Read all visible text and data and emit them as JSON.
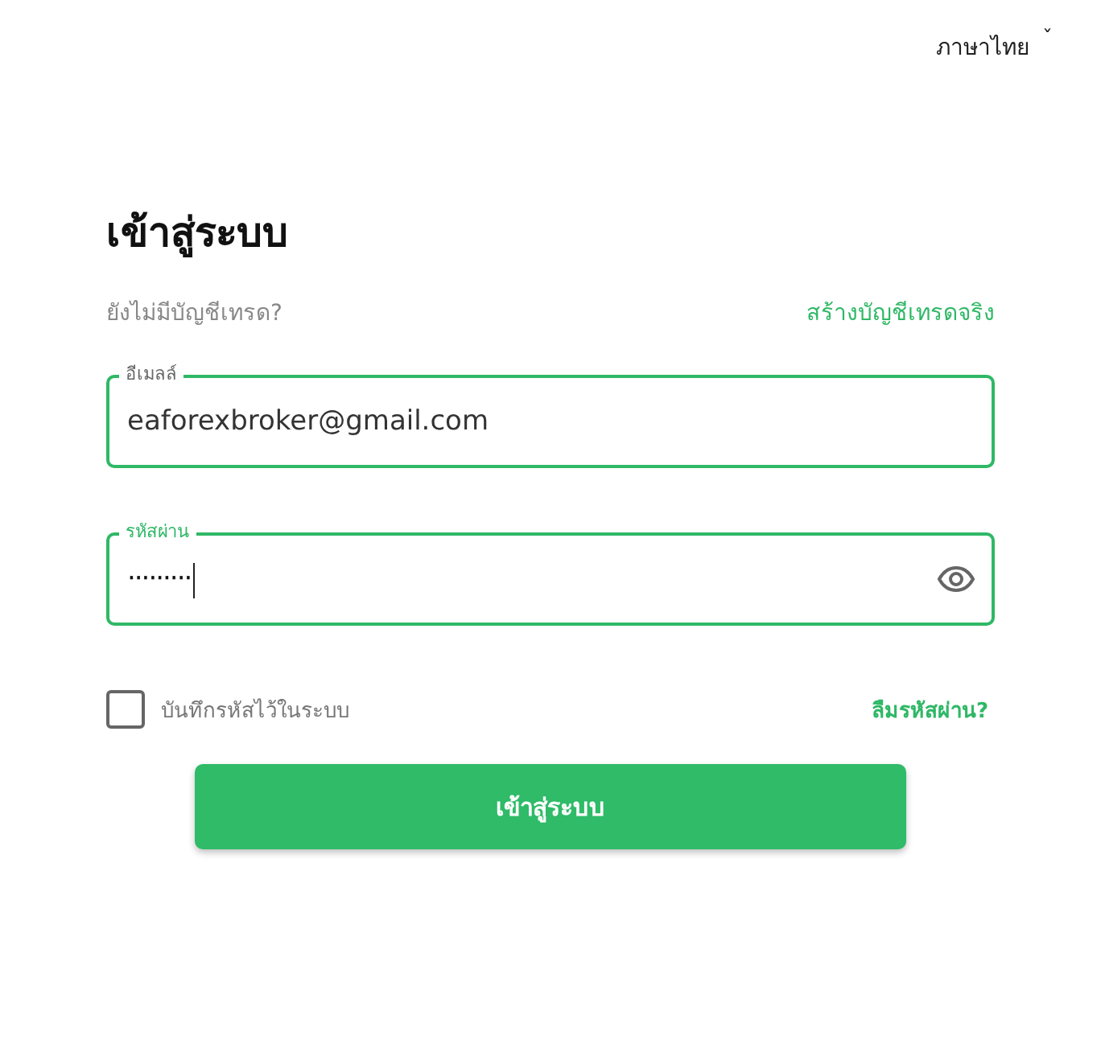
{
  "language": {
    "label": "ภาษาไทย",
    "caret": "ˇ"
  },
  "title": "เข้าสู่ระบบ",
  "signup": {
    "prompt": "ยังไม่มีบัญชีเทรด?",
    "link": "สร้างบัญชีเทรดจริง"
  },
  "fields": [
    {
      "label": "อีเมลล์",
      "value": "eaforexbroker@gmail.com",
      "focused": false,
      "kind": "text"
    },
    {
      "label": "รหัสผ่าน",
      "value": "·········",
      "focused": true,
      "kind": "password"
    }
  ],
  "remember": {
    "label": "บันทึกรหัสไว้ในระบบ",
    "checked": false
  },
  "forgot": "ลืมรหัสผ่าน?",
  "submit": "เข้าสู่ระบบ"
}
